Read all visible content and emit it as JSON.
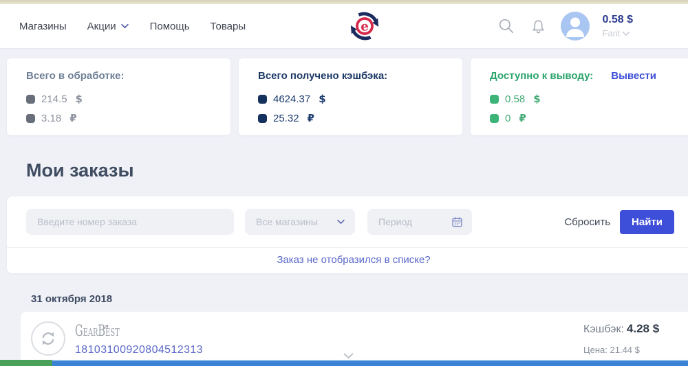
{
  "colors": {
    "accent-blue": "#3d4ed8",
    "link-blue": "#5a68c9",
    "navy": "#1d3a67",
    "green": "#2aa46a",
    "gray-title": "#6f8096",
    "gray-value": "#8d949f",
    "heading": "#3e4b60",
    "logo-red": "#d5294a",
    "logo-navy": "#1c2b5e",
    "balance": "#2b3a8e",
    "strip-green": "#4ba05a",
    "strip-blue": "#3c82d4",
    "top-strip": "#e8e6d0"
  },
  "icons": {
    "site-logo-icon": "red e in circular navy arrows",
    "search-icon": "magnifier",
    "bell-icon": "bell outline",
    "avatar-icon": "person silhouette in blue circle",
    "chevron-down-icon": "chevron down",
    "calendar-icon": "calendar outline",
    "refresh-icon": "circular two arrows",
    "external-link-icon": "arrow up-right"
  },
  "header": {
    "nav": [
      {
        "label": "Магазины"
      },
      {
        "label": "Акции"
      },
      {
        "label": "Помощь"
      },
      {
        "label": "Товары"
      }
    ],
    "balance": "0.58 $",
    "username": "Farit"
  },
  "summary_cards": [
    {
      "title": "Всего в обработке:",
      "rows": [
        {
          "amount": "214.5",
          "currency": "$"
        },
        {
          "amount": "3.18",
          "currency": "₽"
        }
      ]
    },
    {
      "title": "Всего получено кэшбэка:",
      "rows": [
        {
          "amount": "4624.37",
          "currency": "$"
        },
        {
          "amount": "25.32",
          "currency": "₽"
        }
      ]
    },
    {
      "title": "Доступно к выводу:",
      "action_label": "Вывести",
      "rows": [
        {
          "amount": "0.58",
          "currency": "$"
        },
        {
          "amount": "0",
          "currency": "₽"
        }
      ]
    }
  ],
  "orders_section": {
    "title": "Мои заказы",
    "filters": {
      "order_number_placeholder": "Введите номер заказа",
      "shop_select_value": "Все магазины",
      "period_placeholder": "Период",
      "reset_label": "Сбросить",
      "find_label": "Найти",
      "missing_order_link": "Заказ не отобразился в списке?"
    },
    "date_group": "31 октября 2018",
    "order": {
      "shop": "GearBest",
      "order_number": "18103100920804512313",
      "cashback_label": "Кэшбэк:",
      "cashback_value": "4.28 $",
      "price_label": "Цена:",
      "price_value": "21.44 $"
    }
  }
}
